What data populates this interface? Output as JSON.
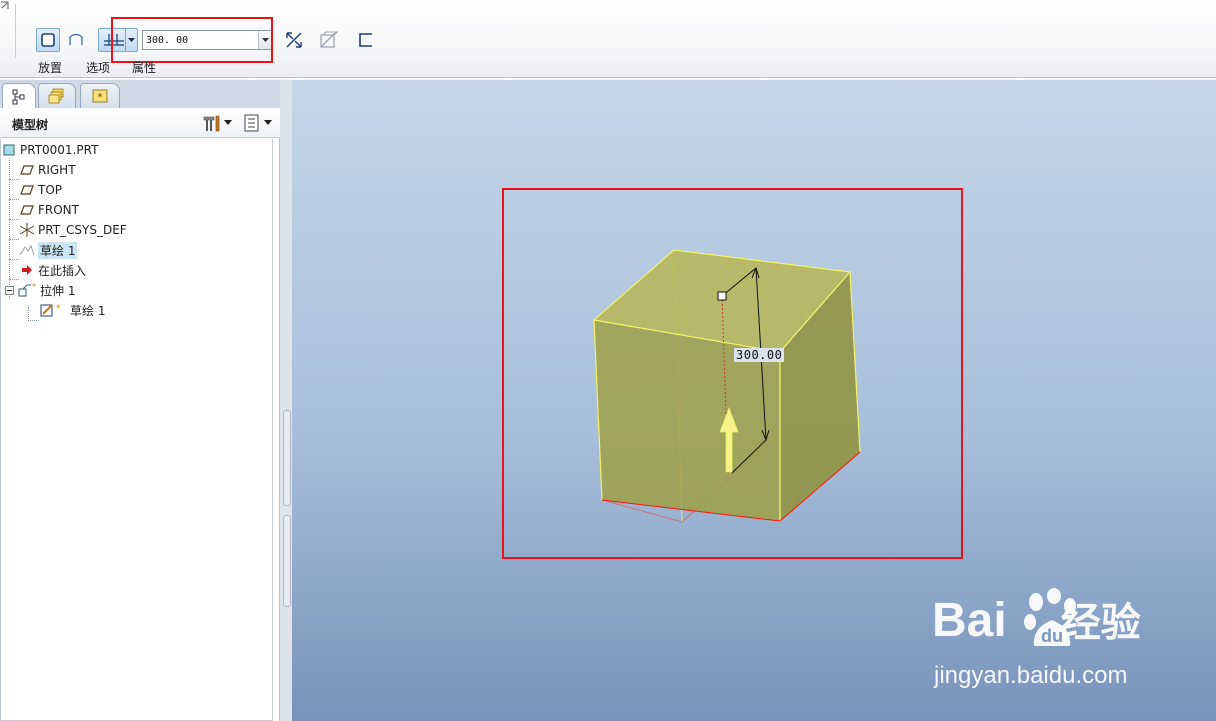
{
  "dashboard": {
    "placement_label": "放置",
    "options_label": "选项",
    "properties_label": "属性",
    "depth_value": "300. 00"
  },
  "navigator": {
    "model_tree_title": "模型树",
    "tree": {
      "root": "PRT0001.PRT",
      "right": "RIGHT",
      "top": "TOP",
      "front": "FRONT",
      "csys": "PRT_CSYS_DEF",
      "sketch1": "草绘 1",
      "insert_here": "在此插入",
      "extrude1": "拉伸 1",
      "child_sketch": "草绘 1"
    }
  },
  "viewport": {
    "dimension_label": "300.00"
  },
  "watermark": {
    "brand": "Bai",
    "brand_cn": "经验",
    "url": "jingyan.baidu.com"
  },
  "colors": {
    "highlight_red": "#e8141b",
    "solid_fill": "#9fa048",
    "edge_yellow": "#f4f36a",
    "selection_blue": "#c9e6f2"
  }
}
